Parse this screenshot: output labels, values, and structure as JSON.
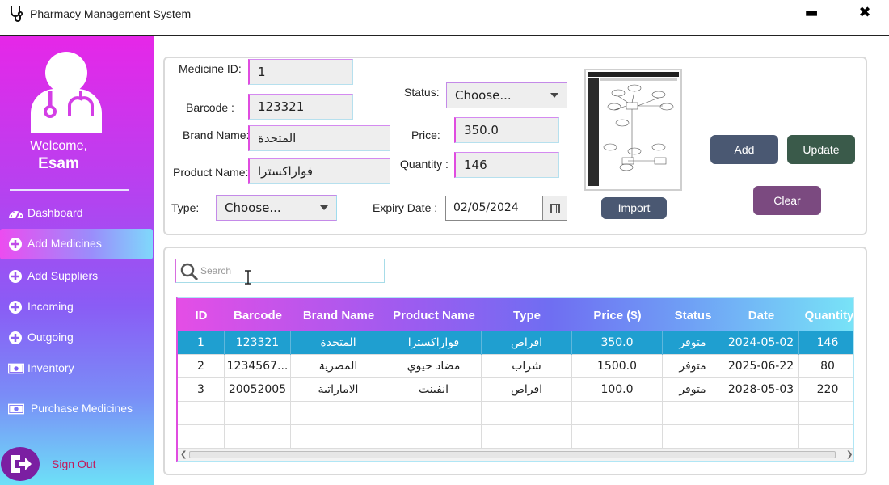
{
  "window": {
    "title": "Pharmacy Management System",
    "minimize": "▬",
    "close": "✖"
  },
  "sidebar": {
    "welcome": "Welcome,",
    "username": "Esam",
    "items": [
      {
        "label": "Dashboard",
        "icon": "dashboard-icon"
      },
      {
        "label": "Add Medicines",
        "icon": "plus-circle-icon",
        "active": true
      },
      {
        "label": "Add Suppliers",
        "icon": "plus-circle-icon"
      },
      {
        "label": "Incoming",
        "icon": "plus-circle-icon"
      },
      {
        "label": "Outgoing",
        "icon": "plus-circle-icon"
      },
      {
        "label": "Inventory",
        "icon": "money-icon"
      },
      {
        "label": "Purchase Medicines",
        "icon": "money-icon"
      }
    ],
    "signout": "Sign Out"
  },
  "form": {
    "medicine_id_label": "Medicine ID:",
    "medicine_id": "1",
    "barcode_label": "Barcode :",
    "barcode": "123321",
    "brand_label": "Brand Name:",
    "brand": "المتحدة",
    "product_label": "Product Name:",
    "product": "فواراكسترا",
    "type_label": "Type:",
    "type_value": "Choose...",
    "status_label": "Status:",
    "status_value": "Choose...",
    "price_label": "Price:",
    "price": "350.0",
    "quantity_label": "Quantity :",
    "quantity": "146",
    "expiry_label": "Expiry Date :",
    "expiry": "02/05/2024",
    "import_label": "Import",
    "add_label": "Add",
    "update_label": "Update",
    "clear_label": "Clear"
  },
  "search": {
    "placeholder": "Search"
  },
  "table": {
    "columns": [
      "ID",
      "Barcode",
      "Brand Name",
      "Product Name",
      "Type",
      "Price ($)",
      "Status",
      "Date",
      "Quantity"
    ],
    "rows": [
      [
        "1",
        "123321",
        "المتحدة",
        "فواراكسترا",
        "اقراص",
        "350.0",
        "متوفر",
        "2024-05-02",
        "146"
      ],
      [
        "2",
        "1234567...",
        "المصرية",
        "مضاد حيوي",
        "شراب",
        "1500.0",
        "متوفر",
        "2025-06-22",
        "80"
      ],
      [
        "3",
        "20052005",
        "الاماراتية",
        "انفينت",
        "اقراص",
        "100.0",
        "متوفر",
        "2028-05-03",
        "220"
      ]
    ],
    "selected_row": 0
  },
  "colors": {
    "sidebar_top": "#e627e8",
    "sidebar_bottom": "#6de0f7",
    "selected_row": "#1f9fd0",
    "add_button": "#4a5872",
    "update_button": "#3a5a4a",
    "clear_button": "#7b4a80"
  }
}
